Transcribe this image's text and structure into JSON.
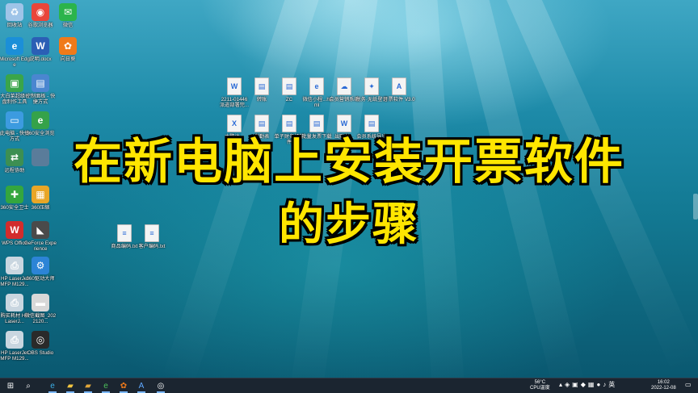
{
  "title_line1": "在新电脑上安装开票软件",
  "title_line2": "的步骤",
  "left_icons": [
    {
      "label": "回收站",
      "icon": "recycle-bin-icon",
      "color": "#9fc4e8",
      "glyph": "♻"
    },
    {
      "label": "谷歌浏览器",
      "icon": "chrome-icon",
      "color": "#e9463a",
      "glyph": "◉"
    },
    {
      "label": "微信",
      "icon": "wechat-icon",
      "color": "#2bb44b",
      "glyph": "✉"
    },
    {
      "label": "Microsoft Edge",
      "icon": "edge-icon",
      "color": "#1b8fd8",
      "glyph": "e"
    },
    {
      "label": "说明.docx",
      "icon": "word-doc-icon",
      "color": "#2b5fb5",
      "glyph": "W"
    },
    {
      "label": "向日葵",
      "icon": "sunflower-icon",
      "color": "#f07a1a",
      "glyph": "✿"
    },
    {
      "label": "大白菜超级U盘制作工具",
      "icon": "usb-tool-icon",
      "color": "#3aa54a",
      "glyph": "▣"
    },
    {
      "label": "控制面板 - 快捷方式",
      "icon": "control-panel-icon",
      "color": "#4a86d0",
      "glyph": "▤"
    },
    {
      "label": "此电脑 - 快捷方式",
      "icon": "this-pc-icon",
      "color": "#3c9be0",
      "glyph": "▭"
    },
    {
      "label": "360安全浏览",
      "icon": "browser-360-icon",
      "color": "#35a24a",
      "glyph": "e"
    },
    {
      "label": "远程协助",
      "icon": "remote-icon",
      "color": "#3d8f52",
      "glyph": "⇄"
    },
    {
      "label": "",
      "icon": "blank-icon",
      "color": "#5a7c9a",
      "glyph": ""
    },
    {
      "label": "360安全卫士",
      "icon": "security-360-icon",
      "color": "#34a63e",
      "glyph": "✚"
    },
    {
      "label": "360压缩",
      "icon": "zip-360-icon",
      "color": "#e8a627",
      "glyph": "▦"
    },
    {
      "label": "WPS Office",
      "icon": "wps-icon",
      "color": "#d22c2c",
      "glyph": "W"
    },
    {
      "label": "GeForce Experience",
      "icon": "geforce-icon",
      "color": "#4a4a4a",
      "glyph": "◣"
    },
    {
      "label": "HP LaserJet MFP M129...",
      "icon": "printer-icon",
      "color": "#c9d6e0",
      "glyph": "⎙"
    },
    {
      "label": "360驱动大师",
      "icon": "driver-360-icon",
      "color": "#2c84d6",
      "glyph": "⚙"
    },
    {
      "label": "购买耗材 HP LaserJ...",
      "icon": "printer-supplies-icon",
      "color": "#c9d6e0",
      "glyph": "⎙"
    },
    {
      "label": "微信截图_2022120...",
      "icon": "screenshot-icon",
      "color": "#d8d8d8",
      "glyph": "▬"
    },
    {
      "label": "HP LaserJet MFP M129...",
      "icon": "printer-icon",
      "color": "#c9d6e0",
      "glyph": "⎙"
    },
    {
      "label": "OBS Studio",
      "icon": "obs-icon",
      "color": "#2a2a2a",
      "glyph": "◎"
    }
  ],
  "center_icons_row1": [
    {
      "label": "2211-01446 派遣部署完...",
      "icon": "word-doc-icon",
      "glyph": "W"
    },
    {
      "label": "转账",
      "icon": "document-icon",
      "glyph": "▤"
    },
    {
      "label": "ZC",
      "icon": "document-icon",
      "glyph": "▤"
    },
    {
      "label": "微信小程...html",
      "icon": "html-icon",
      "glyph": "e"
    },
    {
      "label": "会员营销系统",
      "icon": "cloud-app-icon",
      "glyph": "☁"
    },
    {
      "label": "税务·无纸登记",
      "icon": "tax-app-icon",
      "glyph": "✦"
    },
    {
      "label": "开票软件 V3.0",
      "icon": "invoice-app-icon",
      "glyph": "A"
    }
  ],
  "center_icons_row2": [
    {
      "label": "大鹏计...",
      "icon": "excel-doc-icon",
      "glyph": "X"
    },
    {
      "label": "考勤表",
      "icon": "document-icon",
      "glyph": "▤"
    },
    {
      "label": "单子财务打印件",
      "icon": "document-icon",
      "glyph": "▤"
    },
    {
      "label": "批量发票下载",
      "icon": "document-icon",
      "glyph": "▤"
    },
    {
      "label": "出账单...",
      "icon": "word-doc-icon",
      "glyph": "W"
    },
    {
      "label": "会员系统导出",
      "icon": "document-icon",
      "glyph": "▤"
    }
  ],
  "txt_files": [
    {
      "label": "商品编码.txt",
      "icon": "text-file-icon"
    },
    {
      "label": "客户编码.txt",
      "icon": "text-file-icon"
    }
  ],
  "taskbar": {
    "apps": [
      {
        "icon": "windows-start-icon",
        "glyph": "⊞",
        "color": "#ffffff"
      },
      {
        "icon": "search-icon",
        "glyph": "⌕",
        "color": "#ffffff"
      },
      {
        "icon": "edge-icon",
        "glyph": "e",
        "color": "#3cb0e8"
      },
      {
        "icon": "file-explorer-icon",
        "glyph": "▰",
        "color": "#f3c641"
      },
      {
        "icon": "folder-icon",
        "glyph": "▰",
        "color": "#e0a63a"
      },
      {
        "icon": "browser-360-icon",
        "glyph": "e",
        "color": "#4bc05a"
      },
      {
        "icon": "sunflower-icon",
        "glyph": "✿",
        "color": "#f07a1a"
      },
      {
        "icon": "invoice-app-icon",
        "glyph": "A",
        "color": "#5fa8ff"
      },
      {
        "icon": "obs-icon",
        "glyph": "◎",
        "color": "#ffffff"
      }
    ],
    "temperature": "56°C",
    "cpu_label": "CPU温度",
    "time": "16:02",
    "date": "2022-12-08"
  }
}
